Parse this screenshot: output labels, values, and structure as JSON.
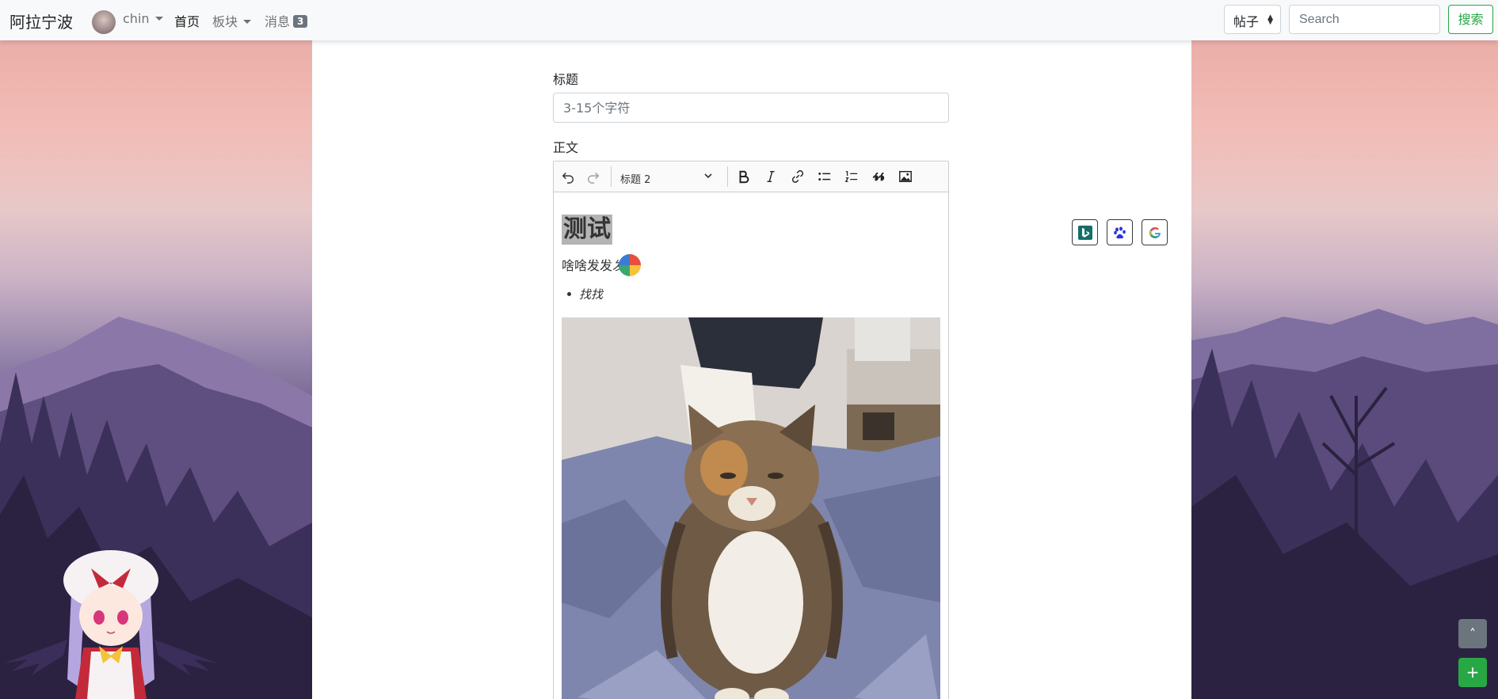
{
  "navbar": {
    "brand": "阿拉宁波",
    "user": "chin",
    "links": {
      "home": "首页",
      "boards": "板块",
      "messages": "消息"
    },
    "message_count": "3",
    "search_type": "帖子",
    "search_placeholder": "Search",
    "search_button": "搜索"
  },
  "form": {
    "title_label": "标题",
    "title_placeholder": "3-15个字符",
    "body_label": "正文"
  },
  "editor": {
    "heading_select": "标题 2",
    "content": {
      "heading": "测试",
      "paragraph": "啥啥发发",
      "paragraph_italic": "发",
      "bullet": "找找"
    }
  },
  "share": {
    "bing_icon": "bing-icon",
    "baidu_icon": "baidu-paw-icon",
    "google_icon": "google-icon"
  },
  "floating": {
    "to_top": "˄",
    "new_post": "+"
  },
  "colors": {
    "accent_green": "#28a745",
    "badge_gray": "#6c757d"
  }
}
